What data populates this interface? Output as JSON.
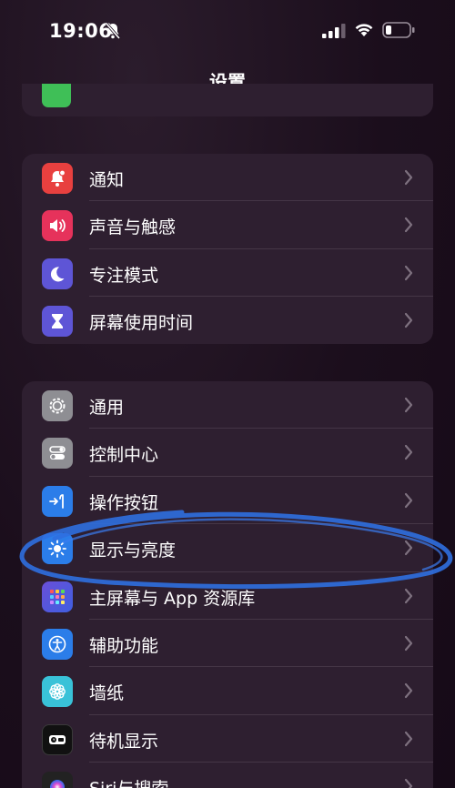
{
  "status_bar": {
    "time": "19:06"
  },
  "nav": {
    "title": "设置"
  },
  "group_a": [
    {
      "label": "通知",
      "icon": "bell-icon",
      "color": "#e8403f"
    },
    {
      "label": "声音与触感",
      "icon": "speaker-icon",
      "color": "#e6325b"
    },
    {
      "label": "专注模式",
      "icon": "moon-icon",
      "color": "#5e55d6"
    },
    {
      "label": "屏幕使用时间",
      "icon": "hourglass-icon",
      "color": "#5e55d6"
    }
  ],
  "group_b": [
    {
      "label": "通用",
      "icon": "gear-icon",
      "color": "#8e8e93"
    },
    {
      "label": "控制中心",
      "icon": "toggles-icon",
      "color": "#8e8e93"
    },
    {
      "label": "操作按钮",
      "icon": "action-button-icon",
      "color": "#2b7de9"
    },
    {
      "label": "显示与亮度",
      "icon": "sun-icon",
      "color": "#2b7de9"
    },
    {
      "label": "主屏幕与 App 资源库",
      "icon": "home-screen-icon",
      "color": "#5a4fd0"
    },
    {
      "label": "辅助功能",
      "icon": "accessibility-icon",
      "color": "#2b7de9"
    },
    {
      "label": "墙纸",
      "icon": "flower-icon",
      "color": "#39c2d8"
    },
    {
      "label": "待机显示",
      "icon": "standby-icon",
      "color": "#111111"
    },
    {
      "label": "Siri与搜索",
      "icon": "siri-icon",
      "color": "#222222"
    }
  ],
  "annotation": {
    "color": "#2f6fe0"
  }
}
